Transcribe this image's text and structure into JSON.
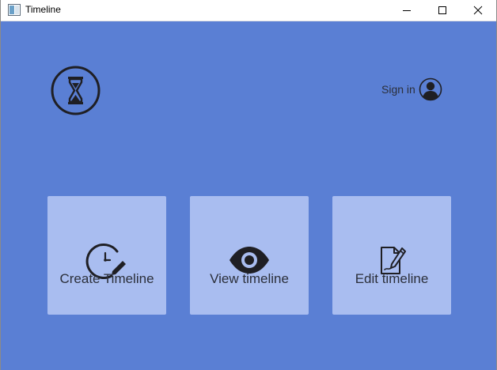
{
  "window": {
    "title": "Timeline",
    "controls": {
      "minimize": "minimize",
      "maximize": "maximize",
      "close": "close"
    }
  },
  "header": {
    "logo_icon": "hourglass-icon",
    "sign_in_label": "Sign in",
    "sign_in_icon": "user-avatar-icon"
  },
  "cards": [
    {
      "label": "Create Timeline",
      "icon": "clock-edit-icon"
    },
    {
      "label": "View timeline",
      "icon": "eye-icon"
    },
    {
      "label": "Edit timeline",
      "icon": "document-edit-icon"
    }
  ],
  "colors": {
    "background": "#5a7fd4",
    "card": "#a9bdf0",
    "icon": "#1f1f24",
    "text": "#2b2f3a"
  }
}
